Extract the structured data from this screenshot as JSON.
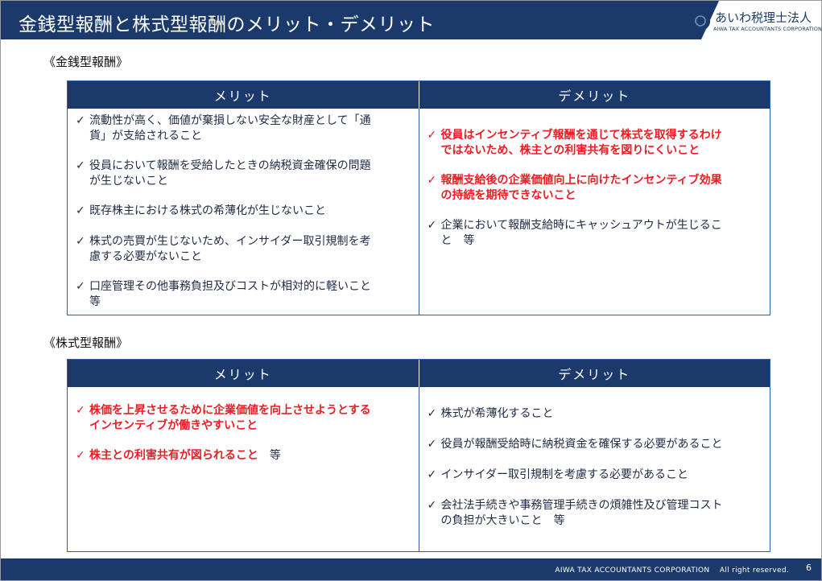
{
  "title": "金銭型報酬と株式型報酬のメリット・デメリット",
  "logo": {
    "name": "あいわ税理士法人",
    "sub": "AIWA TAX ACCOUNTANTS CORPORATION"
  },
  "sections": [
    {
      "label": "《金銭型報酬》",
      "headers": [
        "メリット",
        "デメリット"
      ],
      "merits": [
        {
          "l1": "流動性が高く、価値が棄損しない安全な財産として「通",
          "l2": "貨」が支給されること"
        },
        {
          "l1": "役員において報酬を受給したときの納税資金確保の問題",
          "l2": "が生じないこと"
        },
        {
          "l1": "既存株主における株式の希薄化が生じないこと",
          "l2": ""
        },
        {
          "l1": "株式の売買が生じないため、インサイダー取引規制を考",
          "l2": "慮する必要がないこと"
        },
        {
          "l1": "口座管理その他事務負担及びコストが相対的に軽いこと",
          "l2": "等"
        }
      ],
      "demerits": [
        {
          "l1": "役員はインセンティブ報酬を通じて株式を取得するわけ",
          "l2": "ではないため、株主との利害共有を図りにくいこと"
        },
        {
          "l1": "報酬支給後の企業価値向上に向けたインセンティブ効果",
          "l2": "の持続を期待できないこと"
        },
        {
          "l1": "企業において報酬支給時にキャッシュアウトが生じるこ",
          "l2": "と　等"
        }
      ]
    },
    {
      "label": "《株式型報酬》",
      "headers": [
        "メリット",
        "デメリット"
      ],
      "merits": [
        {
          "l1": "株価を上昇させるために企業価値を向上させようとする",
          "l2": "インセンティブが働きやすいこと"
        },
        {
          "l1": "株主との利害共有が図られること",
          "suffix": "　等"
        }
      ],
      "demerits": [
        {
          "l1": "株式が希薄化すること",
          "l2": ""
        },
        {
          "l1": "役員が報酬受給時に納税資金を確保する必要があること",
          "l2": ""
        },
        {
          "l1": "インサイダー取引規制を考慮する必要があること",
          "l2": ""
        },
        {
          "l1": "会社法手続きや事務管理手続きの煩雑性及び管理コスト",
          "l2": "の負担が大きいこと　等"
        }
      ]
    }
  ],
  "check_mark": "✓",
  "footer": {
    "text": "AIWA TAX ACCOUNTANTS CORPORATION　 All right reserved.",
    "page": "6"
  },
  "colors": {
    "navy": "#1b3a6b",
    "border": "#2e5ea8",
    "red": "#ee1c24"
  }
}
